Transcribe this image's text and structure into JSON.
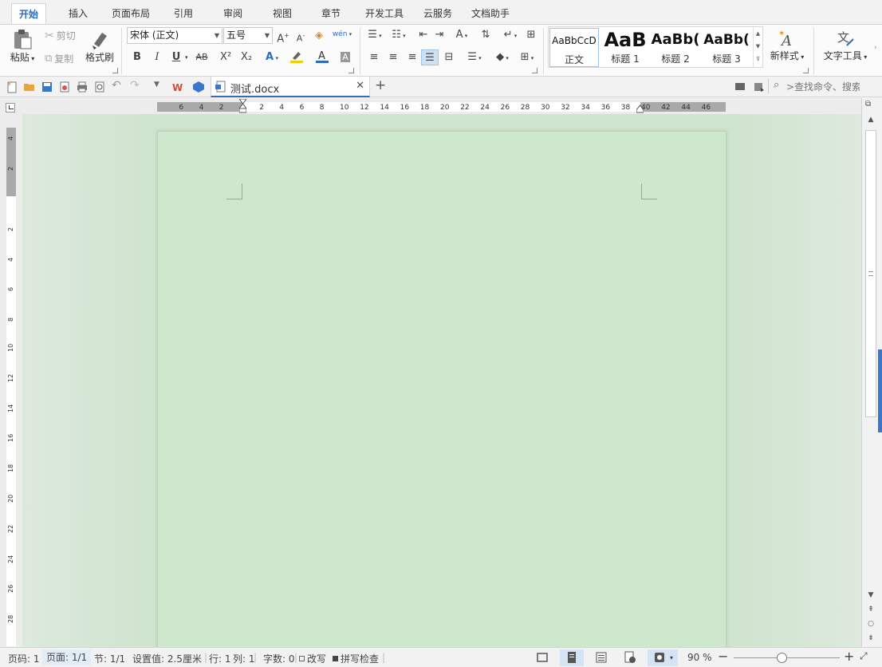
{
  "menu_tabs": [
    {
      "label": "开始",
      "active": true
    },
    {
      "label": "插入"
    },
    {
      "label": "页面布局"
    },
    {
      "label": "引用"
    },
    {
      "label": "审阅"
    },
    {
      "label": "视图"
    },
    {
      "label": "章节"
    },
    {
      "label": "开发工具"
    },
    {
      "label": "云服务"
    },
    {
      "label": "文档助手"
    }
  ],
  "clipboard": {
    "paste": "粘贴",
    "cut": "剪切",
    "copy": "复制",
    "format_painter": "格式刷"
  },
  "font": {
    "family": "宋体 (正文)",
    "size": "五号",
    "bold": "B",
    "italic": "I",
    "underline": "U",
    "strikethrough": "AB",
    "superscript": "X²",
    "subscript": "X₂",
    "pinyin": "wén"
  },
  "styles": [
    {
      "sample": "AaBbCcD",
      "name": "正文",
      "selected": true
    },
    {
      "sample": "AaB",
      "name": "标题 1"
    },
    {
      "sample": "AaBb(",
      "name": "标题 2"
    },
    {
      "sample": "AaBb(",
      "name": "标题 3"
    }
  ],
  "ribbon_right": {
    "new_style": "新样式",
    "text_tools": "文字工具"
  },
  "document_tab": {
    "filename": "测试.docx"
  },
  "search": {
    "placeholder": ">查找命令、搜索..."
  },
  "ruler": {
    "horizontal_ticks": [
      "6",
      "4",
      "2",
      "2",
      "4",
      "6",
      "8",
      "10",
      "12",
      "14",
      "16",
      "18",
      "20",
      "22",
      "24",
      "26",
      "28",
      "30",
      "32",
      "34",
      "36",
      "38",
      "40",
      "42",
      "44",
      "46"
    ],
    "vertical_ticks": [
      "4",
      "2",
      "2",
      "4",
      "6",
      "8",
      "10",
      "12",
      "14",
      "16",
      "18",
      "20",
      "22",
      "24",
      "26",
      "28"
    ]
  },
  "status_bar": {
    "page_num": "页码: 1",
    "page": "页面: 1/1",
    "section": "节: 1/1",
    "setting": "设置值: 2.5厘米",
    "row": "行: 1",
    "col": "列: 1",
    "word_count": "字数: 0",
    "revision": "改写",
    "spellcheck": "拼写检查",
    "zoom": "90 %"
  },
  "zoom_level": 0.45,
  "colors": {
    "accent": "#2b6cc4",
    "document_bg": "#cee8cd",
    "font_color_bar": "#2b6cc4",
    "highlight_bar": "#f0d000"
  },
  "icons": [
    "paste-icon",
    "cut-icon",
    "copy-icon",
    "format-painter-icon",
    "font-color-icon",
    "highlight-icon",
    "new-style-icon",
    "text-tools-icon",
    "new-doc-icon",
    "open-icon",
    "save-icon",
    "print-icon",
    "undo-icon",
    "redo-icon",
    "wps-icon",
    "cloud-icon",
    "search-icon",
    "zoom-in-icon",
    "zoom-out-icon"
  ]
}
